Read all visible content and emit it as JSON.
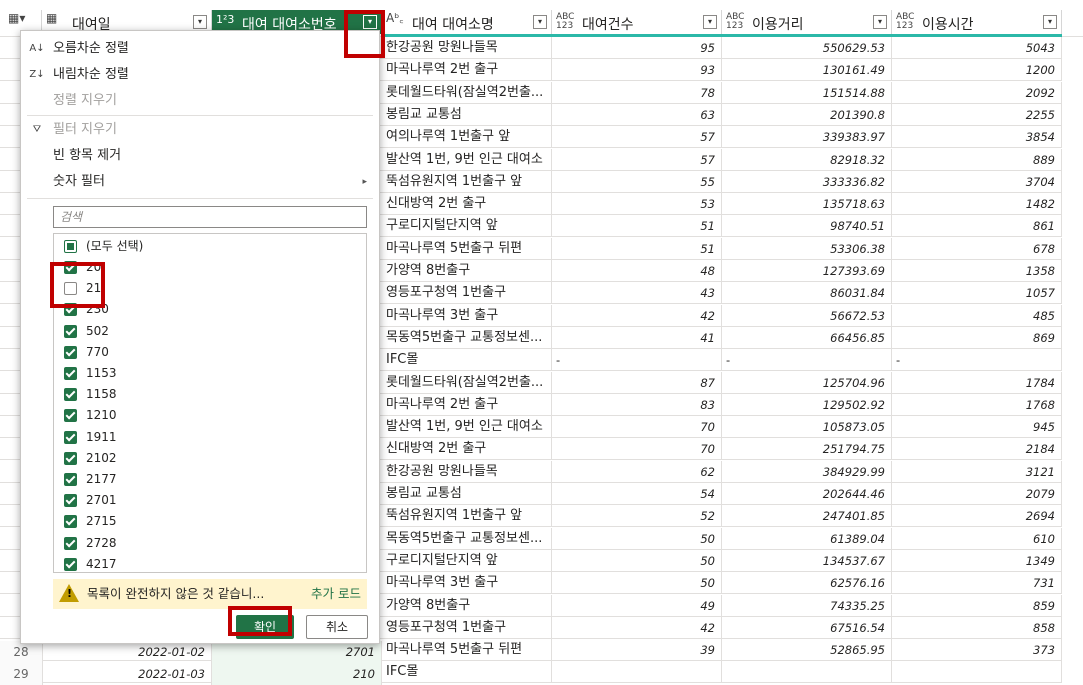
{
  "columns": [
    {
      "type": "table-icon",
      "name": "대여일"
    },
    {
      "type": "1²3",
      "name": "대여 대여소번호"
    },
    {
      "type": "A B C",
      "name": "대여 대여소명"
    },
    {
      "type": "ABC 123",
      "name": "대여건수"
    },
    {
      "type": "ABC 123",
      "name": "이용거리"
    },
    {
      "type": "ABC 123",
      "name": "이용시간"
    }
  ],
  "menu": {
    "sort_asc": "오름차순 정렬",
    "sort_desc": "내림차순 정렬",
    "clear_sort": "정렬 지우기",
    "clear_filter": "필터 지우기",
    "remove_empty": "빈 항목 제거",
    "number_filter": "숫자 필터",
    "search_placeholder": "검색",
    "select_all": "(모두 선택)",
    "items": [
      {
        "label": "20",
        "checked": true
      },
      {
        "label": "21",
        "checked": false
      },
      {
        "label": "230",
        "checked": true
      },
      {
        "label": "502",
        "checked": true
      },
      {
        "label": "770",
        "checked": true
      },
      {
        "label": "1153",
        "checked": true
      },
      {
        "label": "1158",
        "checked": true
      },
      {
        "label": "1210",
        "checked": true
      },
      {
        "label": "1911",
        "checked": true
      },
      {
        "label": "2102",
        "checked": true
      },
      {
        "label": "2177",
        "checked": true
      },
      {
        "label": "2701",
        "checked": true
      },
      {
        "label": "2715",
        "checked": true
      },
      {
        "label": "2728",
        "checked": true
      },
      {
        "label": "4217",
        "checked": true
      }
    ],
    "warning": "목록이 완전하지 않은 것 같습니...",
    "load_more": "추가 로드",
    "ok": "확인",
    "cancel": "취소"
  },
  "rows": [
    {
      "name": "한강공원 망원나들목",
      "count": "95",
      "dist": "550629.53",
      "time": "5043"
    },
    {
      "name": "마곡나루역 2번 출구",
      "count": "93",
      "dist": "130161.49",
      "time": "1200"
    },
    {
      "name": "롯데월드타워(잠실역2번출...",
      "count": "78",
      "dist": "151514.88",
      "time": "2092"
    },
    {
      "name": "봉림교 교통섬",
      "count": "63",
      "dist": "201390.8",
      "time": "2255"
    },
    {
      "name": "여의나루역 1번출구 앞",
      "count": "57",
      "dist": "339383.97",
      "time": "3854"
    },
    {
      "name": "발산역 1번, 9번 인근 대여소",
      "count": "57",
      "dist": "82918.32",
      "time": "889"
    },
    {
      "name": "뚝섬유원지역 1번출구 앞",
      "count": "55",
      "dist": "333336.82",
      "time": "3704"
    },
    {
      "name": "신대방역 2번 출구",
      "count": "53",
      "dist": "135718.63",
      "time": "1482"
    },
    {
      "name": "구로디지털단지역 앞",
      "count": "51",
      "dist": "98740.51",
      "time": "861"
    },
    {
      "name": "마곡나루역 5번출구 뒤편",
      "count": "51",
      "dist": "53306.38",
      "time": "678"
    },
    {
      "name": "가양역 8번출구",
      "count": "48",
      "dist": "127393.69",
      "time": "1358"
    },
    {
      "name": "영등포구청역 1번출구",
      "count": "43",
      "dist": "86031.84",
      "time": "1057"
    },
    {
      "name": "마곡나루역 3번 출구",
      "count": "42",
      "dist": "56672.53",
      "time": "485"
    },
    {
      "name": "목동역5번출구 교통정보센...",
      "count": "41",
      "dist": "66456.85",
      "time": "869"
    },
    {
      "name": "IFC몰",
      "count": "-",
      "dist": "-",
      "time": "-",
      "null": true
    },
    {
      "name": "롯데월드타워(잠실역2번출...",
      "count": "87",
      "dist": "125704.96",
      "time": "1784"
    },
    {
      "name": "마곡나루역 2번 출구",
      "count": "83",
      "dist": "129502.92",
      "time": "1768"
    },
    {
      "name": "발산역 1번, 9번 인근 대여소",
      "count": "70",
      "dist": "105873.05",
      "time": "945"
    },
    {
      "name": "신대방역 2번 출구",
      "count": "70",
      "dist": "251794.75",
      "time": "2184"
    },
    {
      "name": "한강공원 망원나들목",
      "count": "62",
      "dist": "384929.99",
      "time": "3121"
    },
    {
      "name": "봉림교 교통섬",
      "count": "54",
      "dist": "202644.46",
      "time": "2079"
    },
    {
      "name": "뚝섬유원지역 1번출구 앞",
      "count": "52",
      "dist": "247401.85",
      "time": "2694"
    },
    {
      "name": "목동역5번출구 교통정보센...",
      "count": "50",
      "dist": "61389.04",
      "time": "610"
    },
    {
      "name": "구로디지털단지역 앞",
      "count": "50",
      "dist": "134537.67",
      "time": "1349"
    },
    {
      "name": "마곡나루역 3번 출구",
      "count": "50",
      "dist": "62576.16",
      "time": "731"
    },
    {
      "name": "가양역 8번출구",
      "count": "49",
      "dist": "74335.25",
      "time": "859"
    },
    {
      "name": "영등포구청역 1번출구",
      "count": "42",
      "dist": "67516.54",
      "time": "858"
    },
    {
      "name": "마곡나루역 5번출구 뒤편",
      "count": "39",
      "dist": "52865.95",
      "time": "373"
    },
    {
      "name": "IFC몰",
      "count": "",
      "dist": "",
      "time": ""
    }
  ],
  "left_rows": [
    {
      "num": "28",
      "date": "2022-01-02",
      "station": "2701"
    },
    {
      "num": "29",
      "date": "2022-01-03",
      "station": "210"
    }
  ],
  "colors": {
    "accent": "#217346",
    "highlight": "#c00000",
    "quality_bar": "#2bb8a8"
  }
}
